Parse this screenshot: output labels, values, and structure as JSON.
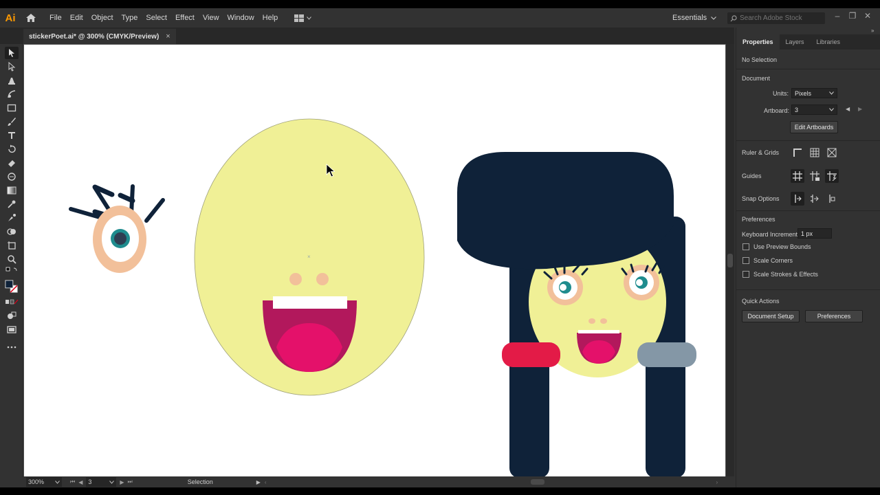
{
  "app": {
    "logo": "Ai",
    "menus": [
      "File",
      "Edit",
      "Object",
      "Type",
      "Select",
      "Effect",
      "View",
      "Window",
      "Help"
    ],
    "workspace": "Essentials",
    "search_placeholder": "Search Adobe Stock"
  },
  "document": {
    "tab_title": "stickerPoet.ai* @ 300% (CMYK/Preview)",
    "close_glyph": "×"
  },
  "status": {
    "zoom": "300%",
    "artboard": "3",
    "tool": "Selection"
  },
  "panel": {
    "tabs": [
      "Properties",
      "Layers",
      "Libraries"
    ],
    "selection": "No Selection",
    "document_section": "Document",
    "units_label": "Units:",
    "units_value": "Pixels",
    "artboard_label": "Artboard:",
    "artboard_value": "3",
    "edit_artboards": "Edit Artboards",
    "ruler_grids": "Ruler & Grids",
    "guides": "Guides",
    "snap_options": "Snap Options",
    "preferences_section": "Preferences",
    "keyboard_increment_label": "Keyboard Increment:",
    "keyboard_increment_value": "1 px",
    "checkboxes": [
      "Use Preview Bounds",
      "Scale Corners",
      "Scale Strokes & Effects"
    ],
    "quick_actions": "Quick Actions",
    "document_setup": "Document Setup",
    "preferences_button": "Preferences"
  },
  "colors": {
    "face_yellow": "#f0f096",
    "hair_navy": "#0f2239",
    "skin_peach": "#f2c09a",
    "mouth_dark": "#b2185c",
    "mouth_pink": "#e4116a",
    "eye_teal": "#1f8c8e",
    "band_red": "#e31b47",
    "band_gray": "#8497a6",
    "accent": "#ff9a00"
  }
}
